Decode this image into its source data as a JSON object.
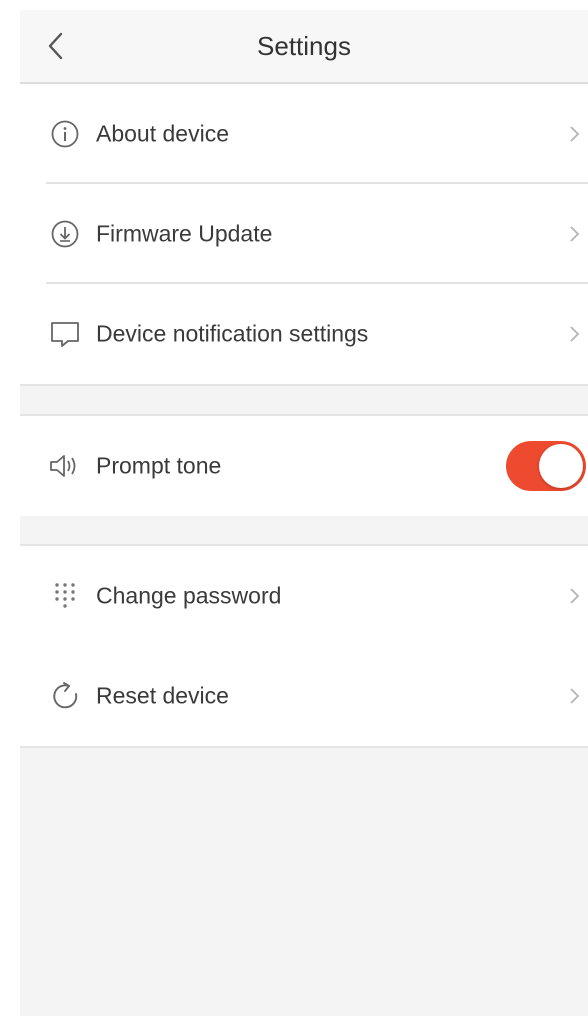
{
  "header": {
    "title": "Settings",
    "back_icon": "chevron-left-icon"
  },
  "groups": [
    {
      "items": [
        {
          "label": "About device",
          "icon": "info-icon",
          "action": "chevron-right-icon"
        },
        {
          "label": "Firmware Update",
          "icon": "download-icon",
          "action": "chevron-right-icon"
        },
        {
          "label": "Device notification settings",
          "icon": "message-icon",
          "action": "chevron-right-icon"
        }
      ]
    },
    {
      "items": [
        {
          "label": "Prompt tone",
          "icon": "speaker-icon",
          "toggle_on": true,
          "toggle_color": "#ee4a2f"
        }
      ]
    },
    {
      "items": [
        {
          "label": "Change password",
          "icon": "keypad-icon",
          "action": "chevron-right-icon"
        },
        {
          "label": "Reset device",
          "icon": "refresh-icon",
          "action": "chevron-right-icon"
        }
      ]
    }
  ]
}
